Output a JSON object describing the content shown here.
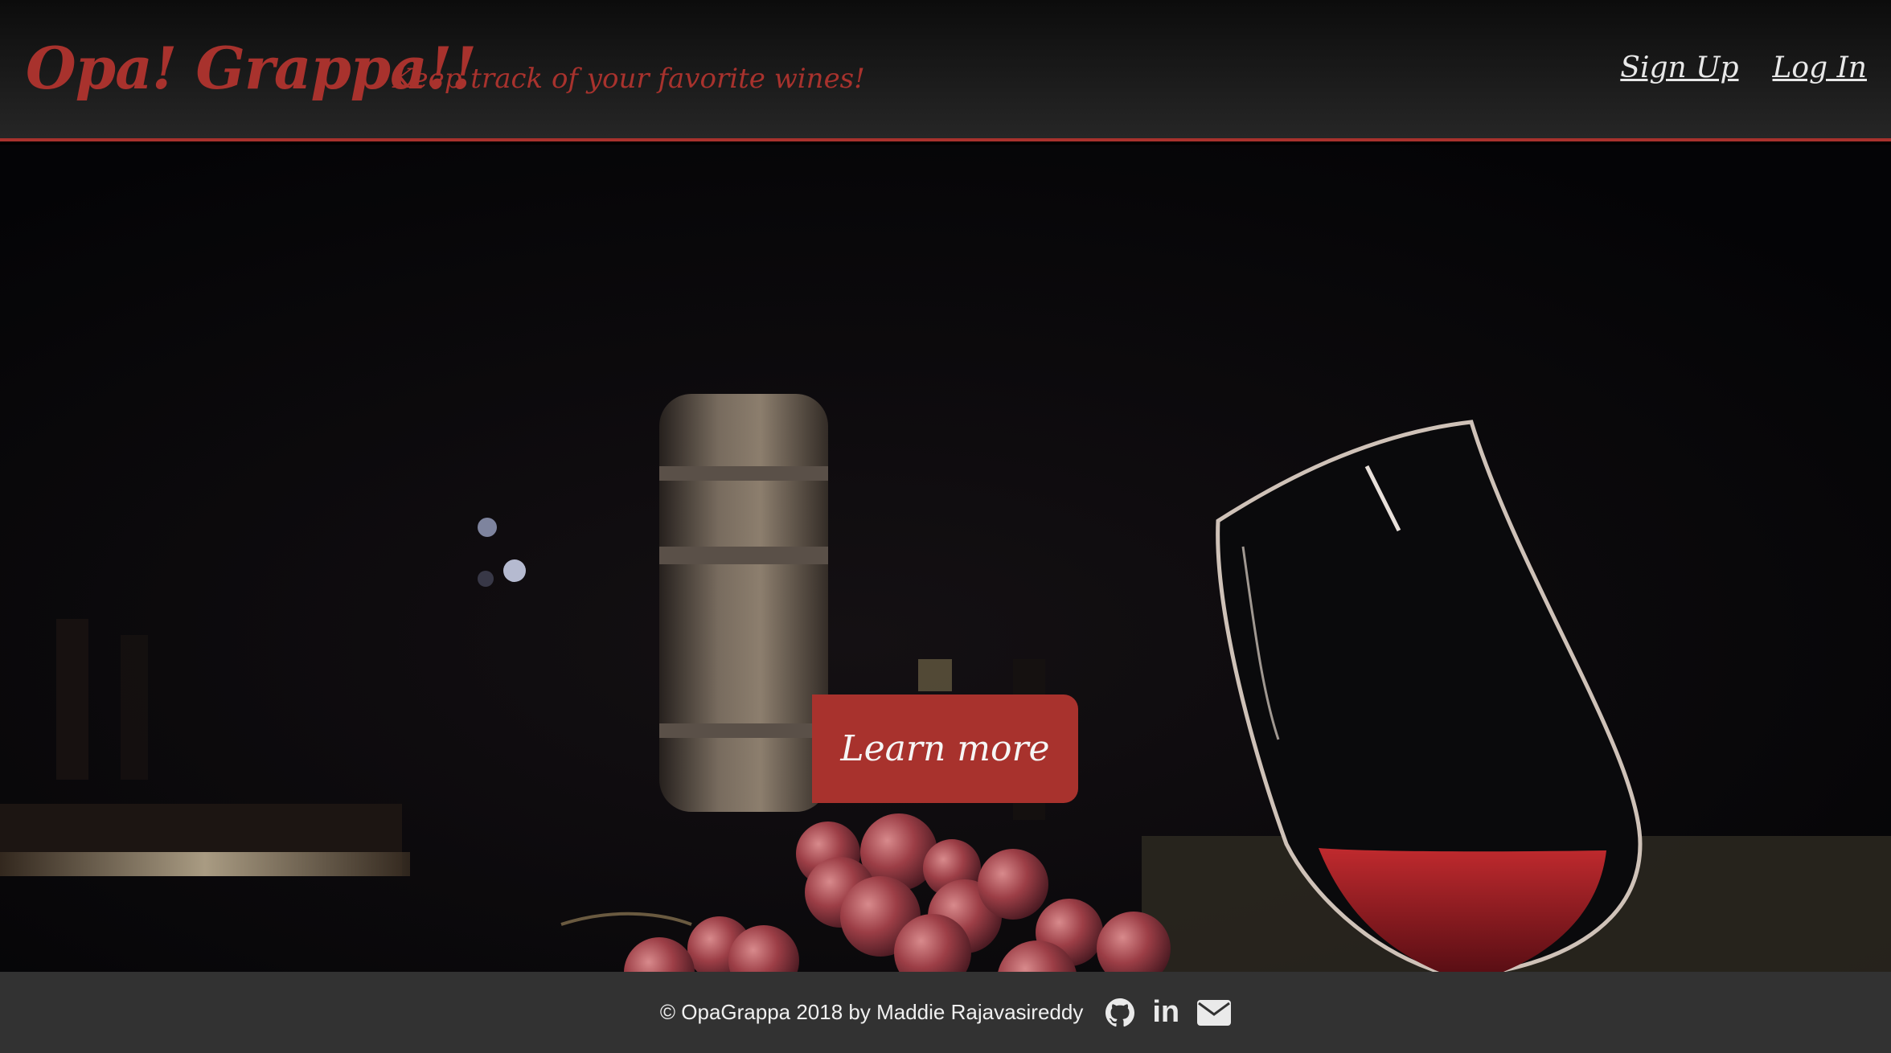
{
  "header": {
    "brand": "Opa! Grappa!!",
    "tagline": "Keep track of your favorite wines!",
    "nav": {
      "sign_up": "Sign Up",
      "log_in": "Log In"
    }
  },
  "hero": {
    "cta_label": "Learn more"
  },
  "footer": {
    "copyright": "© OpaGrappa 2018 by Maddie Rajavasireddy",
    "icons": [
      "github-icon",
      "linkedin-icon",
      "envelope-icon"
    ],
    "linkedin_glyph": "in"
  },
  "colors": {
    "accent": "#a8322d",
    "footer_bg": "#323232",
    "header_bg": "#1a1a1a"
  }
}
